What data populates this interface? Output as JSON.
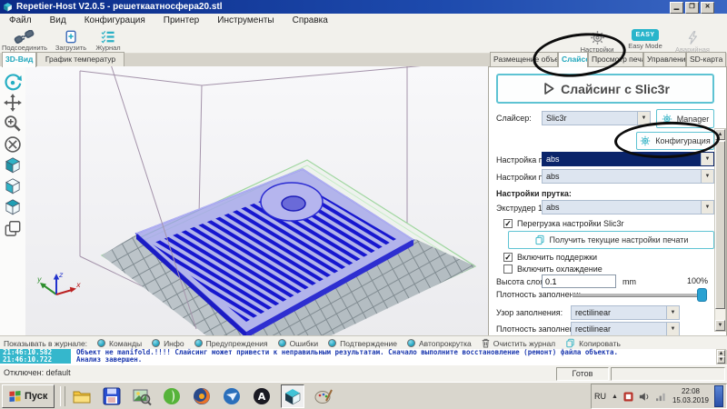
{
  "window": {
    "title": "Repetier-Host V2.0.5 - решеткаатносфера20.stl"
  },
  "menu": {
    "items": [
      "Файл",
      "Вид",
      "Конфигурация",
      "Принтер",
      "Инструменты",
      "Справка"
    ]
  },
  "toolbar": {
    "connect": "Подсоединить",
    "load": "Загрузить",
    "journal": "Журнал",
    "printer_settings": "Настройки принтера",
    "easy_badge": "EASY",
    "easy_mode": "Easy Mode",
    "emergency": "Аварийная остановка"
  },
  "left_tabs": {
    "view3d": "3D-Вид",
    "temp_graph": "График температур"
  },
  "right_tabs": {
    "placement": "Размещение объекта",
    "slicer": "Слайсер",
    "preview": "Просмотр печати",
    "control": "Управление",
    "sd": "SD-карта"
  },
  "slicer_panel": {
    "slice_button": "Слайсинг с Slic3r",
    "slicer_label": "Слайсер:",
    "slicer_value": "Slic3r",
    "manager_button": "Manager",
    "configuration_button": "Конфигурация",
    "print_setting_label": "Настройка печати:",
    "print_setting_value": "abs",
    "printer_settings_label": "Настройки принтера:",
    "printer_settings_value": "abs",
    "filament_settings_label": "Настройки прутка:",
    "extruder1_label": "Экструдер 1:",
    "extruder1_value": "abs",
    "override_checkbox": "Перегрузка настройки Slic3r",
    "fetch_button": "Получить текущие настройки печати",
    "supports_checkbox": "Включить поддержки",
    "cooling_checkbox": "Включить охлаждение",
    "layer_height_label": "Высота слоя:",
    "layer_height_value": "0.1",
    "layer_height_unit": "mm",
    "infill_density_label": "Плотность заполнени:",
    "infill_density_value": "100%",
    "infill_pattern_label": "Узор заполнения:",
    "infill_pattern_value": "rectilinear",
    "solid_pattern_label": "Плотность заполнени:",
    "solid_pattern_value": "rectilinear"
  },
  "axis": {
    "x": "x",
    "y": "y",
    "z": "z"
  },
  "log": {
    "show_label": "Показывать в журнале:",
    "toggles": [
      "Команды",
      "Инфо",
      "Предупреждения",
      "Ошибки",
      "Подтверждение",
      "Автопрокрутка"
    ],
    "clear_button": "Очистить журнал",
    "copy_button": "Копировать",
    "entries": [
      {
        "time": "21:46:10.582",
        "message": "Объект не manifold.!!!! Слайсинг может привести к неправильным результатам. Сначало выполните восстановление (ремонт) файла объекта."
      },
      {
        "time": "21:46:10.722",
        "message": "Анализ завершен."
      }
    ]
  },
  "status": {
    "connection": "Отключен: default",
    "ready": "Готов"
  },
  "taskbar": {
    "start": "Пуск",
    "language": "RU",
    "time": "22:08",
    "date": "15.03.2019"
  },
  "colors": {
    "accent": "#2ab0c5",
    "selection": "#0a246a",
    "log_time_bg": "#35b7cc",
    "object_blue": "#2b2bd2"
  }
}
